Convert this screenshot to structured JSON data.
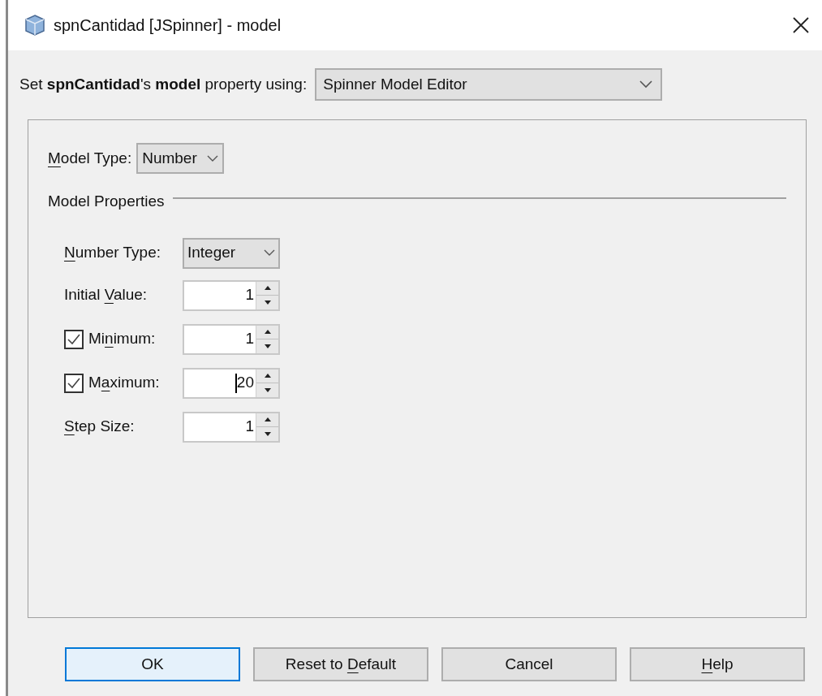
{
  "window": {
    "title": "spnCantidad [JSpinner] - model"
  },
  "editor_row": {
    "text": "Set **spnCantidad**'s **model** property using:",
    "editor": "Spinner Model Editor"
  },
  "model_type": {
    "label": {
      "key": "M",
      "post": "odel Type:"
    },
    "value": "Number"
  },
  "section": {
    "title": "Model Properties"
  },
  "number_type": {
    "label": {
      "key": "N",
      "post": "umber Type:"
    },
    "value": "Integer"
  },
  "properties": [
    {
      "kind": "plain",
      "label": {
        "pre": "Initial ",
        "key": "V",
        "post": "alue:"
      },
      "value": "1",
      "caret": false
    },
    {
      "kind": "checkbox",
      "checked": true,
      "label": {
        "pre": "Mi",
        "key": "n",
        "post": "imum:"
      },
      "value": "1",
      "caret": false
    },
    {
      "kind": "checkbox",
      "checked": true,
      "label": {
        "pre": "M",
        "key": "a",
        "post": "ximum:"
      },
      "value": "20",
      "caret": true
    },
    {
      "kind": "plain",
      "label": {
        "key": "S",
        "post": "tep Size:"
      },
      "value": "1",
      "caret": false
    }
  ],
  "buttons": [
    {
      "label": {
        "pre": "OK"
      },
      "default": true
    },
    {
      "label": {
        "pre": "Reset to ",
        "key": "D",
        "post": "efault"
      },
      "default": false
    },
    {
      "label": {
        "pre": "Cancel"
      },
      "default": false
    },
    {
      "label": {
        "key": "H",
        "post": "elp"
      },
      "default": false
    }
  ]
}
